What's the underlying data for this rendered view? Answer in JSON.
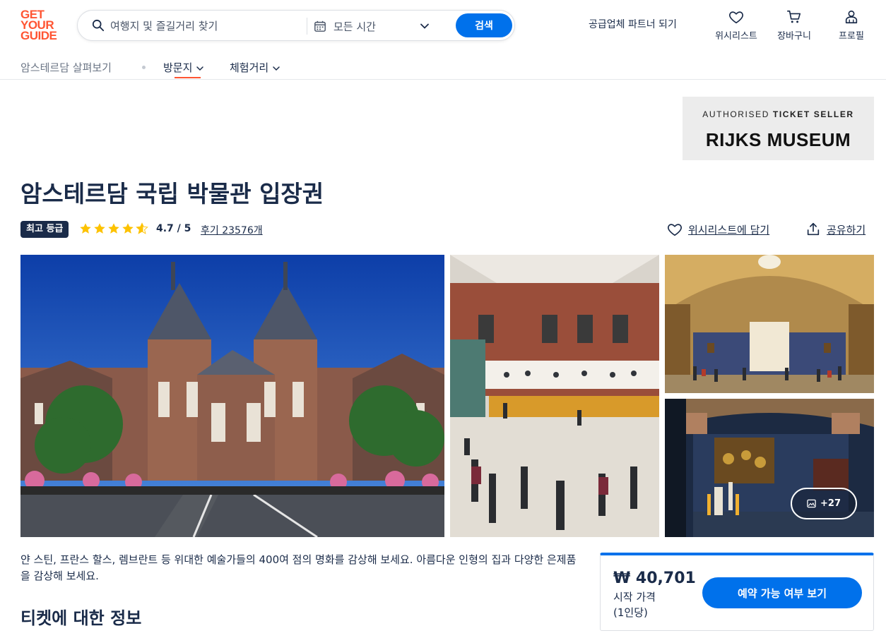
{
  "brand": {
    "logo_lines": [
      "GET",
      "YOUR",
      "GUIDE"
    ],
    "accent_color": "#ff5533",
    "primary_color": "#0071eb"
  },
  "header": {
    "search_placeholder": "여행지 및 즐길거리 찾기",
    "date_label": "모든 시간",
    "search_button": "검색",
    "partner_link": "공급업체 파트너 되기",
    "wishlist_label": "위시리스트",
    "cart_label": "장바구니",
    "profile_label": "프로필"
  },
  "subnav": {
    "breadcrumb": "암스테르담 살펴보기",
    "tabs": [
      {
        "label": "방문지",
        "active": true
      },
      {
        "label": "체험거리",
        "active": false
      }
    ]
  },
  "seller": {
    "line1_normal": "AUTHORISED ",
    "line1_bold": "TICKET SELLER",
    "museum_name": "RIJKS MUSEUM"
  },
  "product": {
    "title": "암스테르담 국립 박물관 입장권",
    "badge": "최고 등급",
    "rating_stars": 4.7,
    "rating_text": "4.7 / 5",
    "reviews_text": "후기 23576개",
    "wishlist_action": "위시리스트에 담기",
    "share_action": "공유하기"
  },
  "gallery": {
    "images": [
      {
        "icon": "rijksmuseum-exterior-photo"
      },
      {
        "icon": "atrium-interior-photo"
      },
      {
        "icon": "gallery-hall-photo"
      },
      {
        "icon": "night-watch-room-photo"
      }
    ],
    "more_count": "+27"
  },
  "description": "얀 스틴, 프란스 할스, 렘브란트 등 위대한 예술가들의 400여 점의 명화를 감상해 보세요. 아름다운 인형의 집과 다양한 은제품을 감상해 보세요.",
  "section_title": "티켓에 대한 정보",
  "booking": {
    "price": "₩ 40,701",
    "from_label": "시작 가격",
    "per_person": "(1인당)",
    "button": "예약 가능 여부 보기"
  }
}
